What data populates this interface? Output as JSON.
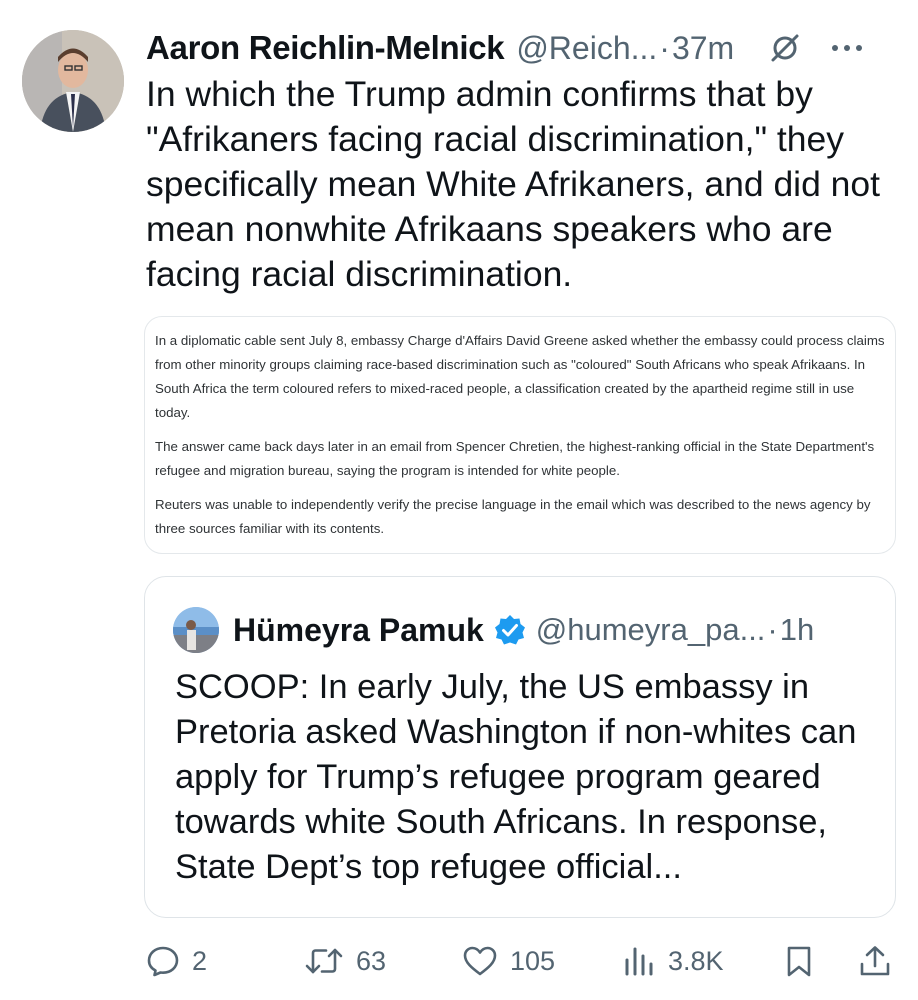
{
  "tweet": {
    "author_name": "Aaron Reichlin-Melnick",
    "handle": "@Reich...",
    "separator": "·",
    "time": "37m",
    "text": "In which the Trump admin confirms that by \"Afrikaners facing racial discrimination,\" they specifically mean White Afrikaners, and did not mean nonwhite Afrikaans speakers who are facing racial discrimination."
  },
  "excerpt": {
    "paragraphs": [
      "In a diplomatic cable sent July 8, embassy Charge d'Affairs David Greene asked whether the embassy could process claims from other minority groups claiming race-based discrimination such as \"coloured\" South Africans who speak Afrikaans. In South Africa the term coloured refers to mixed-raced people, a classification created by the apartheid regime still in use today.",
      "The answer came back days later in an email from Spencer Chretien, the highest-ranking official in the State Department's refugee and migration bureau, saying the program is intended for white people.",
      "Reuters was unable to independently verify the precise language in the email which was described to the news agency by three sources familiar with its contents."
    ]
  },
  "quote": {
    "author_name": "Hümeyra Pamuk",
    "handle": "@humeyra_pa...",
    "separator": "·",
    "time": "1h",
    "text": "SCOOP: In early July, the US embassy in Pretoria asked Washington if non-whites can apply for Trump’s refugee program geared towards white South Africans. In response, State Dept’s top refugee official..."
  },
  "actions": {
    "reply_count": "2",
    "retweet_count": "63",
    "like_count": "105",
    "views_count": "3.8K"
  },
  "icons": [
    "mute-icon",
    "more-icon",
    "verified-icon",
    "reply-icon",
    "retweet-icon",
    "like-icon",
    "views-icon",
    "bookmark-icon",
    "share-icon"
  ],
  "colors": {
    "text": "#0f1419",
    "secondary": "#536471",
    "verified": "#1d9bf0",
    "border": "#e4e8eb"
  }
}
